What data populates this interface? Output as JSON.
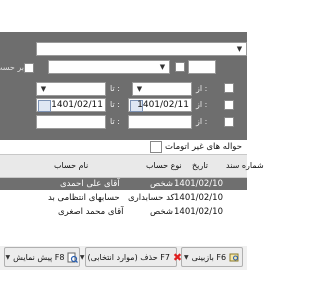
{
  "filters": {
    "search_value": "",
    "account_type_value": "",
    "from_label": "از :",
    "to_label": "تا :",
    "date_from": "1401/02/11",
    "date_to": "1401/02/11",
    "checkbox_label": "بر حسب",
    "filter_tab_label": "حواله های غیر اتومات"
  },
  "grid": {
    "columns": [
      "نام حساب",
      "نوع حساب",
      "تاریخ",
      "شماره سند"
    ],
    "rows": [
      {
        "name": "آقای علی احمدی",
        "type": "شخص",
        "date": "1401/02/10",
        "doc": ""
      },
      {
        "name": "حسابهای انتظامی بد",
        "type": "کد حسابداری",
        "date": "1401/02/10",
        "doc": ""
      },
      {
        "name": "آقای محمد اصغری",
        "type": "شخص",
        "date": "1401/02/10",
        "doc": ""
      }
    ]
  },
  "toolbar": {
    "preview_label": "پیش نمایش F8",
    "delete_label": "حذف (موارد انتخابی) F7",
    "refresh_label": "بازبینی F6"
  },
  "colors": {
    "panel": "#6e6e6e",
    "selected_row": "#6f6f6f",
    "delete_icon": "#e02020"
  }
}
